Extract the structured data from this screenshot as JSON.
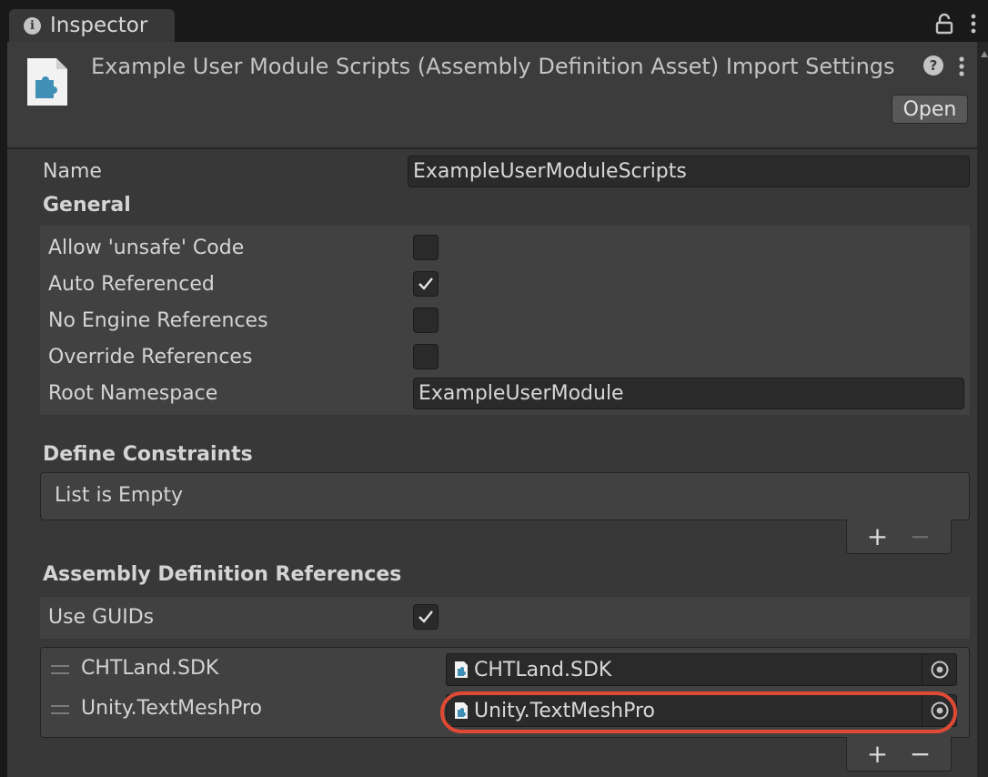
{
  "window": {
    "tab_title": "Inspector"
  },
  "header": {
    "title": "Example User Module Scripts (Assembly Definition Asset) Import Settings",
    "open_label": "Open"
  },
  "fields": {
    "name_label": "Name",
    "name_value": "ExampleUserModuleScripts"
  },
  "general": {
    "heading": "General",
    "allow_unsafe_label": "Allow 'unsafe' Code",
    "allow_unsafe": false,
    "auto_referenced_label": "Auto Referenced",
    "auto_referenced": true,
    "no_engine_refs_label": "No Engine References",
    "no_engine_refs": false,
    "override_refs_label": "Override References",
    "override_refs": false,
    "root_namespace_label": "Root Namespace",
    "root_namespace_value": "ExampleUserModule"
  },
  "define_constraints": {
    "heading": "Define Constraints",
    "empty_text": "List is Empty",
    "add_label": "+",
    "remove_label": "−"
  },
  "assembly_refs": {
    "heading": "Assembly Definition References",
    "use_guids_label": "Use GUIDs",
    "use_guids": true,
    "items": [
      {
        "label": "CHTLand.SDK",
        "value": "CHTLand.SDK"
      },
      {
        "label": "Unity.TextMeshPro",
        "value": "Unity.TextMeshPro"
      }
    ],
    "add_label": "+",
    "remove_label": "−"
  },
  "colors": {
    "highlight": "#e04a34",
    "icon_blue": "#3f8fb6",
    "panel": "#383838"
  },
  "icons": [
    "info-icon",
    "lock-icon",
    "kebab-menu-icon",
    "assembly-asset-icon",
    "help-icon",
    "checkmark-icon",
    "drag-handle-icon",
    "object-picker-icon"
  ]
}
